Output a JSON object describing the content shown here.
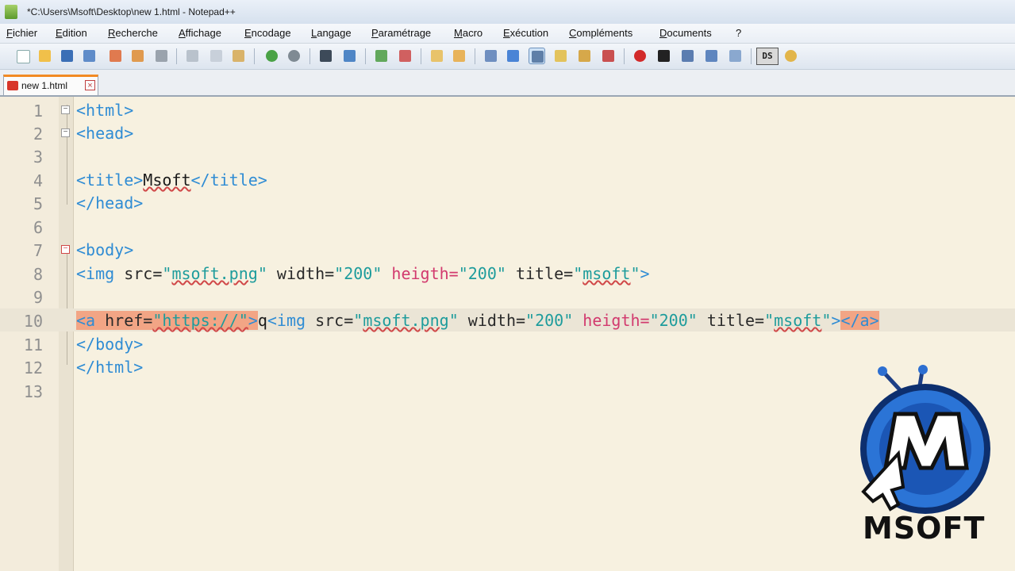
{
  "window": {
    "title": "*C:\\Users\\Msoft\\Desktop\\new  1.html - Notepad++"
  },
  "menu": [
    "Fichier",
    "Edition",
    "Recherche",
    "Affichage",
    "Encodage",
    "Langage",
    "Paramétrage",
    "Macro",
    "Exécution",
    "Compléments",
    "Documents",
    "?"
  ],
  "toolbar": {
    "ds_label": "DS"
  },
  "tabs": [
    {
      "label": "new  1.html",
      "close": "×"
    }
  ],
  "editor": {
    "line_numbers": [
      "1",
      "2",
      "3",
      "4",
      "5",
      "6",
      "7",
      "8",
      "9",
      "10",
      "11",
      "12",
      "13"
    ],
    "current_line": 10
  },
  "code": {
    "l1": "<html>",
    "l2": "<head>",
    "l4_open": "<title>",
    "l4_text": "Msoft",
    "l4_close": "</title>",
    "l5": "</head>",
    "l7": "<body>",
    "l8_img": "<img",
    "l8_src": " src=",
    "l8_src_val_q1": "\"",
    "l8_src_val": "msoft.png",
    "l8_src_val_q2": "\"",
    "l8_width": " width=",
    "l8_width_val": "\"200\"",
    "l8_heigth": " heigth=",
    "l8_heigth_val": "\"200\"",
    "l8_title": " title=",
    "l8_title_q1": "\"",
    "l8_title_val": "msoft",
    "l8_title_q2": "\"",
    "l8_end": ">",
    "l10_a": "<a",
    "l10_sp": " ",
    "l10_href": "href=",
    "l10_href_val": "\"https://\"",
    "l10_a_end": ">",
    "l10_caret": "q",
    "l10_img": "<img",
    "l10_src": " src=",
    "l10_src_q1": "\"",
    "l10_src_val": "msoft.png",
    "l10_src_q2": "\"",
    "l10_width": " width=",
    "l10_width_val": "\"200\"",
    "l10_heigth": " heigth=",
    "l10_heigth_val": "\"200\"",
    "l10_title": " title=",
    "l10_title_q1": "\"",
    "l10_title_val": "msoft",
    "l10_title_q2": "\"",
    "l10_img_end": ">",
    "l10_a_close": "</a>",
    "l11": "</body>",
    "l12": "</html>"
  },
  "watermark": {
    "text": "MSOFT"
  }
}
